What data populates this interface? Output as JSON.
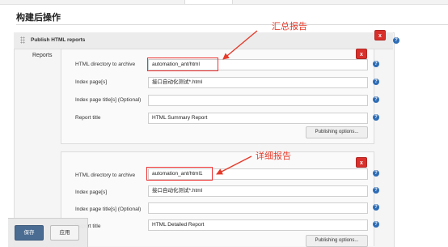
{
  "section": {
    "title": "构建后操作"
  },
  "publisher": {
    "title": "Publish HTML reports",
    "reports_label": "Reports",
    "delete_label": "x",
    "help_glyph": "?"
  },
  "reports": [
    {
      "fields": [
        {
          "label": "HTML directory to archive",
          "value": "automation_ant/html"
        },
        {
          "label": "Index page[s]",
          "value": "接口自动化测试*.html"
        },
        {
          "label": "Index page title[s] (Optional)",
          "value": ""
        },
        {
          "label": "Report title",
          "value": "HTML Summary Report"
        }
      ],
      "publishing_options": "Publishing options...",
      "delete_label": "x"
    },
    {
      "fields": [
        {
          "label": "HTML directory to archive",
          "value": "automation_ant/html1"
        },
        {
          "label": "Index page[s]",
          "value": "接口自动化测试*.html"
        },
        {
          "label": "Index page title[s] (Optional)",
          "value": ""
        },
        {
          "label": "Report title",
          "value": "HTML Detailed Report"
        }
      ],
      "publishing_options": "Publishing options...",
      "delete_label": "x"
    }
  ],
  "annotations": {
    "summary": "汇总报告",
    "detail": "详细报告",
    "color": "#e53a2a"
  },
  "footer": {
    "save_label": "保存",
    "apply_label": "应用"
  },
  "colors": {
    "delete_button": "#d9302c",
    "help_icon": "#2e6cb5",
    "save_button": "#4a6c93"
  }
}
